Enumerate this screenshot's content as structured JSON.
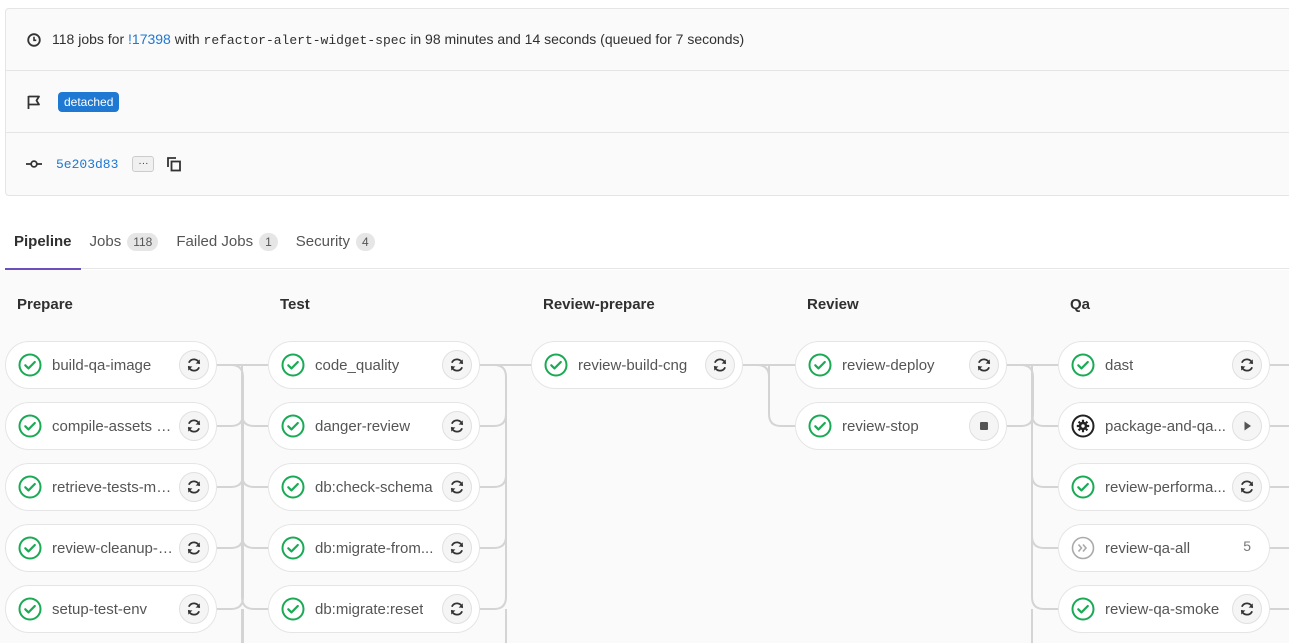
{
  "header": {
    "jobs_count_text": "118 jobs for",
    "mr_link": "!17398",
    "with_text": "with",
    "branch": "refactor-alert-widget-spec",
    "duration_text": "in 98 minutes and 14 seconds (queued for 7 seconds)",
    "badge": "detached",
    "commit_sha": "5e203d83",
    "ellipsis": "···"
  },
  "tabs": [
    {
      "label": "Pipeline",
      "count": null
    },
    {
      "label": "Jobs",
      "count": "118"
    },
    {
      "label": "Failed Jobs",
      "count": "1"
    },
    {
      "label": "Security",
      "count": "4"
    }
  ],
  "stages": [
    {
      "title": "Prepare",
      "jobs": [
        {
          "name": "build-qa-image",
          "status": "success",
          "action": "retry"
        },
        {
          "name": "compile-assets p...",
          "status": "success",
          "action": "retry"
        },
        {
          "name": "retrieve-tests-me...",
          "status": "success",
          "action": "retry"
        },
        {
          "name": "review-cleanup-f...",
          "status": "success",
          "action": "retry"
        },
        {
          "name": "setup-test-env",
          "status": "success",
          "action": "retry"
        }
      ]
    },
    {
      "title": "Test",
      "jobs": [
        {
          "name": "code_quality",
          "status": "success",
          "action": "retry"
        },
        {
          "name": "danger-review",
          "status": "success",
          "action": "retry"
        },
        {
          "name": "db:check-schema",
          "status": "success",
          "action": "retry"
        },
        {
          "name": "db:migrate-from...",
          "status": "success",
          "action": "retry"
        },
        {
          "name": "db:migrate:reset",
          "status": "success",
          "action": "retry"
        }
      ]
    },
    {
      "title": "Review-prepare",
      "jobs": [
        {
          "name": "review-build-cng",
          "status": "success",
          "action": "retry"
        }
      ]
    },
    {
      "title": "Review",
      "jobs": [
        {
          "name": "review-deploy",
          "status": "success",
          "action": "retry"
        },
        {
          "name": "review-stop",
          "status": "success",
          "action": "stop"
        }
      ]
    },
    {
      "title": "Qa",
      "jobs": [
        {
          "name": "dast",
          "status": "success",
          "action": "retry"
        },
        {
          "name": "package-and-qa...",
          "status": "manual",
          "action": "play"
        },
        {
          "name": "review-performa...",
          "status": "success",
          "action": "retry"
        },
        {
          "name": "review-qa-all",
          "status": "skipped",
          "count": "5"
        },
        {
          "name": "review-qa-smoke",
          "status": "success",
          "action": "retry"
        }
      ]
    }
  ],
  "colors": {
    "success": "#1aaa55",
    "link": "#1f78d1",
    "active_tab": "#6b4fbb"
  }
}
